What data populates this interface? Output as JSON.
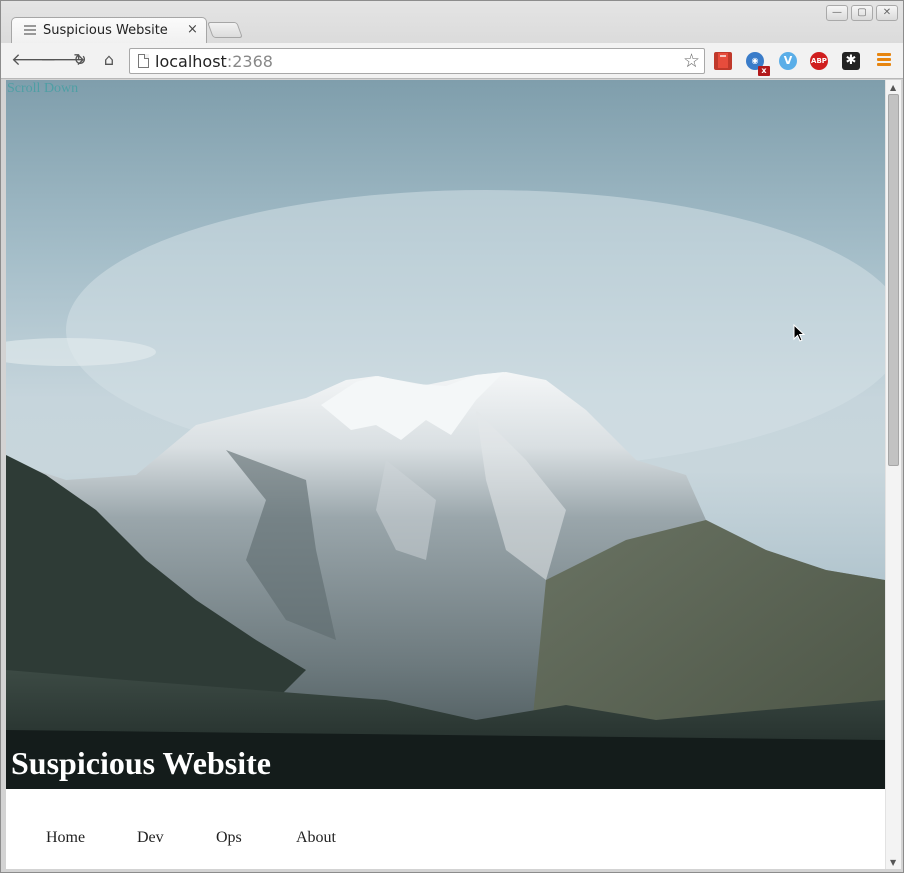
{
  "browser": {
    "tab": {
      "title": "Suspicious Website",
      "close_glyph": "×"
    },
    "window_controls": {
      "minimize": "—",
      "maximize": "▢",
      "close": "✕"
    },
    "toolbar": {
      "back": "🡐",
      "forward": "🡒",
      "reload": "↻",
      "home": "⌂"
    },
    "omnibox": {
      "host": "localhost",
      "port": ":2368",
      "bookmark_glyph": "☆"
    },
    "extensions": [
      {
        "name": "books-extension-icon",
        "glyph": ""
      },
      {
        "name": "rss-extension-icon",
        "glyph": "◉",
        "badge": "x"
      },
      {
        "name": "v-extension-icon",
        "glyph": "V"
      },
      {
        "name": "adblock-plus-icon",
        "glyph": "ABP"
      },
      {
        "name": "asterisk-extension-icon",
        "glyph": "✱"
      }
    ],
    "scrollbar": {
      "up": "▲",
      "down": "▼"
    }
  },
  "page": {
    "scroll_link": "Scroll Down",
    "site_title": "Suspicious Website",
    "nav": [
      "Home",
      "Dev",
      "Ops",
      "About"
    ]
  },
  "colors": {
    "scroll_link": "#2d9f9f",
    "menu_accent": "#e7850f"
  }
}
